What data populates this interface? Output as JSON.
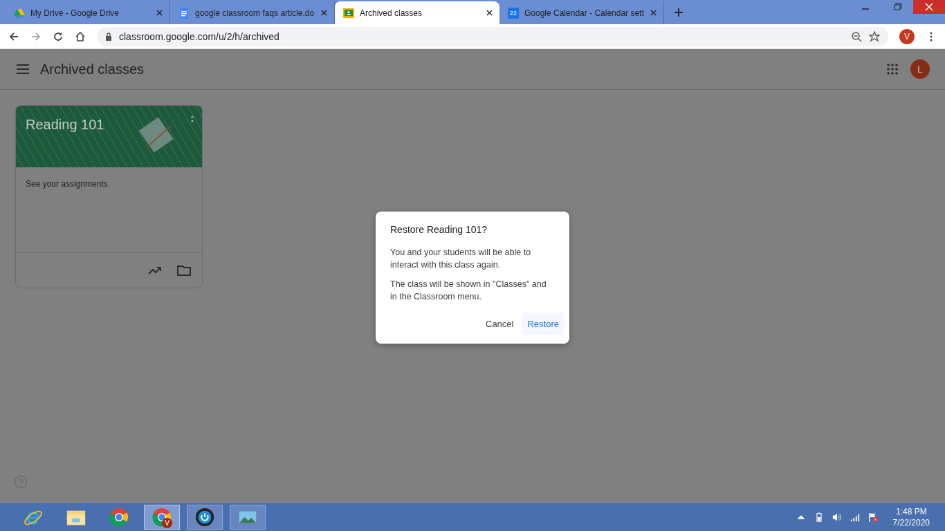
{
  "browser": {
    "tabs": [
      {
        "title": "My Drive - Google Drive",
        "kind": "drive",
        "selected": false
      },
      {
        "title": "google classroom faqs article.do",
        "kind": "docs",
        "selected": false
      },
      {
        "title": "Archived classes",
        "kind": "classroom",
        "selected": true
      },
      {
        "title": "Google Calendar - Calendar sett",
        "kind": "calendar",
        "icon_text": "22",
        "selected": false
      }
    ],
    "url": "classroom.google.com/u/2/h/archived",
    "profile": "V"
  },
  "page": {
    "title": "Archived classes",
    "account": "L",
    "classes": [
      {
        "name": "Reading 101",
        "description": "See your assignments"
      }
    ]
  },
  "dialog": {
    "title": "Restore Reading 101?",
    "paragraphs": [
      "You and your students will be able to interact with this class again.",
      "The class will be shown in \"Classes\" and in the Classroom menu."
    ],
    "buttons": [
      {
        "label": "Cancel",
        "kind": "text"
      },
      {
        "label": "Restore",
        "kind": "primary"
      }
    ]
  },
  "taskbar": {
    "apps": [
      {
        "kind": "ie",
        "selected": false
      },
      {
        "kind": "explorer",
        "selected": false
      },
      {
        "kind": "chrome",
        "selected": false
      },
      {
        "kind": "chrome",
        "badge": "V",
        "selected": true
      },
      {
        "kind": "media",
        "selected": false
      },
      {
        "kind": "photos",
        "selected": false
      }
    ],
    "time": "1:48 PM",
    "date": "7/22/2020"
  }
}
